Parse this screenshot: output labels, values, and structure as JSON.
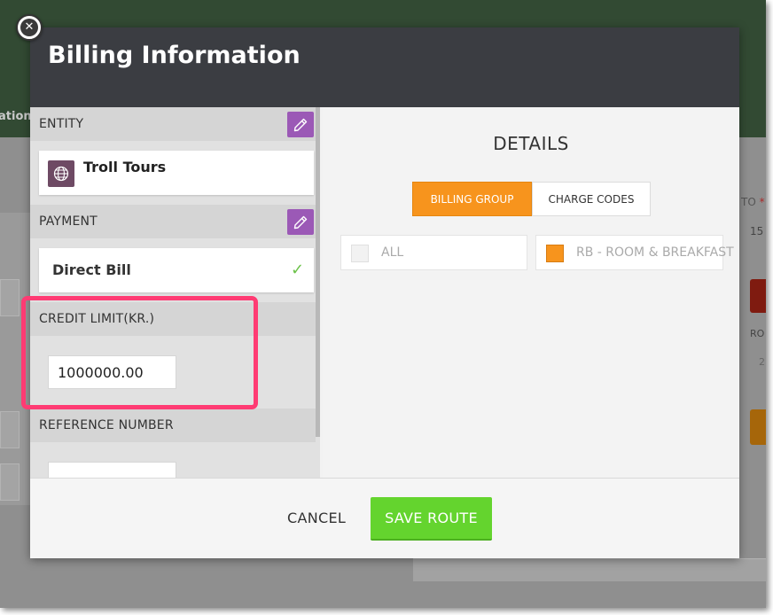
{
  "background": {
    "nav_fragment": "ations",
    "right_label": "TO",
    "right_required_mark": "*",
    "right_value": "15",
    "right_field_label": "RO",
    "right_field_value": "2"
  },
  "modal": {
    "title": "Billing Information",
    "entity": {
      "label": "ENTITY",
      "name": "Troll Tours",
      "icon": "globe-icon"
    },
    "payment": {
      "label": "PAYMENT",
      "method": "Direct Bill",
      "icon": "checkmark-icon"
    },
    "credit_limit": {
      "label": "CREDIT LIMIT(KR.)",
      "value": "1000000.00"
    },
    "reference_number": {
      "label": "REFERENCE NUMBER",
      "value": ""
    },
    "details": {
      "title": "DETAILS",
      "tabs": [
        {
          "label": "BILLING GROUP",
          "active": true
        },
        {
          "label": "CHARGE CODES",
          "active": false
        }
      ],
      "options": [
        {
          "label": "ALL",
          "checked": false
        },
        {
          "label": "RB - ROOM & BREAKFAST",
          "checked": true
        }
      ]
    },
    "footer": {
      "cancel_label": "CANCEL",
      "save_label": "SAVE ROUTE"
    }
  },
  "colors": {
    "header": "#3b3d42",
    "edit_button": "#9b59b6",
    "active_tab": "#f7941d",
    "save_button": "#64d42e",
    "highlight": "#ff3b73"
  }
}
